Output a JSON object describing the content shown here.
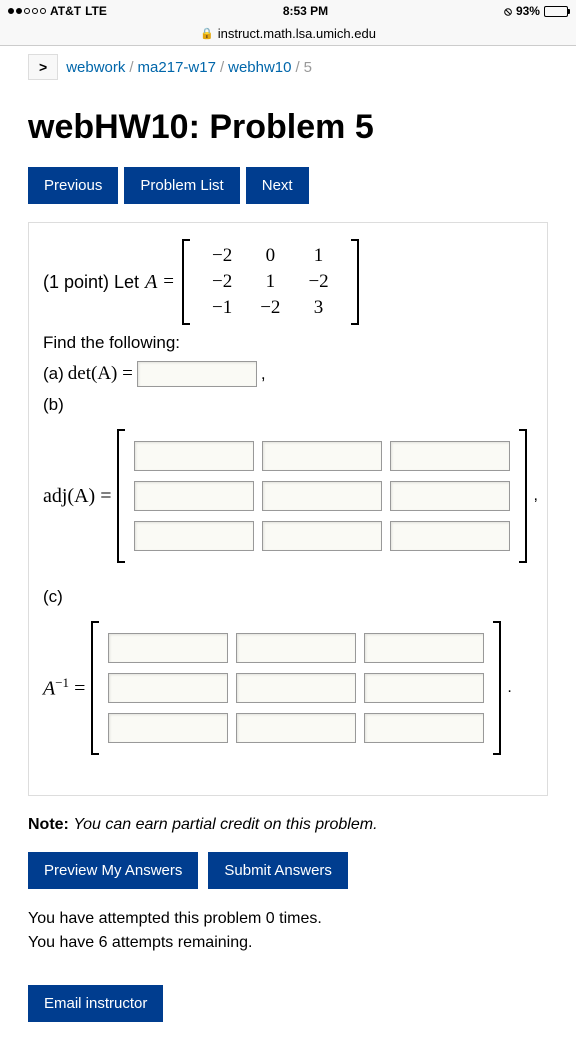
{
  "status": {
    "carrier": "AT&T",
    "network": "LTE",
    "time": "8:53 PM",
    "battery_pct": "93%"
  },
  "url": "instruct.math.lsa.umich.edu",
  "breadcrumb": {
    "items": [
      "webwork",
      "ma217-w17",
      "webhw10"
    ],
    "current": "5"
  },
  "title": "webHW10: Problem 5",
  "nav": {
    "prev": "Previous",
    "list": "Problem List",
    "next": "Next"
  },
  "problem": {
    "points": "(1 point) Let",
    "var": "A",
    "eq": "=",
    "matrix": [
      [
        "−2",
        "0",
        "1"
      ],
      [
        "−2",
        "1",
        "−2"
      ],
      [
        "−1",
        "−2",
        "3"
      ]
    ],
    "find": "Find the following:",
    "a_label": "(a)",
    "a_expr": "det(A) =",
    "b_label": "(b)",
    "adj_label": "adj(A) =",
    "c_label": "(c)",
    "inv_label_a": "A",
    "inv_label_sup": "−1",
    "inv_label_eq": " ="
  },
  "note_label": "Note:",
  "note_text": "You can earn partial credit on this problem.",
  "actions": {
    "preview": "Preview My Answers",
    "submit": "Submit Answers"
  },
  "attempts_line1": "You have attempted this problem 0 times.",
  "attempts_line2": "You have 6 attempts remaining.",
  "email": "Email instructor",
  "chart_data": {
    "type": "table",
    "title": "Matrix A",
    "rows": [
      [
        -2,
        0,
        1
      ],
      [
        -2,
        1,
        -2
      ],
      [
        -1,
        -2,
        3
      ]
    ]
  }
}
